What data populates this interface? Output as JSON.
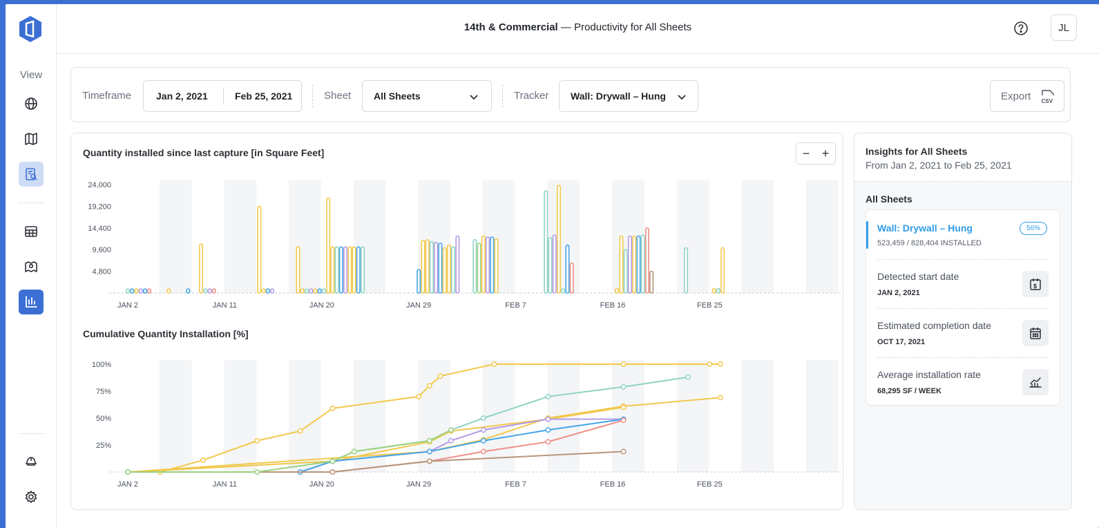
{
  "header": {
    "project": "14th & Commercial",
    "subtitle": " — Productivity for All Sheets",
    "avatar_initials": "JL"
  },
  "sidebar": {
    "view_label": "View",
    "items": [
      {
        "icon": "globe-icon"
      },
      {
        "icon": "map-icon"
      },
      {
        "icon": "report-icon",
        "state": "soft-selected"
      },
      {
        "icon": "table-icon"
      },
      {
        "icon": "map-pin-icon"
      },
      {
        "icon": "bar-chart-icon",
        "state": "active"
      },
      {
        "icon": "hard-hat-icon"
      },
      {
        "icon": "gear-icon"
      }
    ]
  },
  "filters": {
    "timeframe_label": "Timeframe",
    "start_date": "Jan 2, 2021",
    "end_date": "Feb 25, 2021",
    "sheet_label": "Sheet",
    "sheet_value": "All Sheets",
    "tracker_label": "Tracker",
    "tracker_value": "Wall: Drywall – Hung",
    "export_label": "Export",
    "export_icon": "csv-icon"
  },
  "zoom": {
    "minus": "−",
    "plus": "+"
  },
  "colors": {
    "yellow": "#f2c84b",
    "blue": "#45a5e6",
    "teal": "#8fd3c2",
    "purple": "#b59be6",
    "red": "#ee8f86",
    "brown": "#b8947a",
    "green": "#9ad27e",
    "accent": "#3b6fd4"
  },
  "chart_data": [
    {
      "type": "bar",
      "title": "Quantity installed since last capture [in Square Feet]",
      "x_ticks": [
        "JAN 2",
        "JAN 11",
        "JAN 20",
        "JAN 29",
        "FEB 7",
        "FEB 16",
        "FEB 25"
      ],
      "x_start_day": 0,
      "x_end_day": 67,
      "y_ticks": [
        "24,000",
        "19,200",
        "14,400",
        "9,600",
        "4,800"
      ],
      "ylim": [
        0,
        24000
      ],
      "bars": [
        {
          "day": 0.0,
          "color": "teal",
          "value": 300
        },
        {
          "day": 0.4,
          "color": "blue",
          "value": 300
        },
        {
          "day": 0.8,
          "color": "yellow",
          "value": 300
        },
        {
          "day": 1.2,
          "color": "purple",
          "value": 300
        },
        {
          "day": 1.6,
          "color": "blue",
          "value": 300
        },
        {
          "day": 2.0,
          "color": "red",
          "value": 300
        },
        {
          "day": 3.8,
          "color": "yellow",
          "value": 300
        },
        {
          "day": 5.6,
          "color": "blue",
          "value": 300
        },
        {
          "day": 6.8,
          "color": "yellow",
          "value": 10800
        },
        {
          "day": 7.2,
          "color": "teal",
          "value": 300
        },
        {
          "day": 7.6,
          "color": "purple",
          "value": 300
        },
        {
          "day": 8.0,
          "color": "red",
          "value": 300
        },
        {
          "day": 12.2,
          "color": "yellow",
          "value": 19200
        },
        {
          "day": 12.6,
          "color": "yellow",
          "value": 300
        },
        {
          "day": 13.0,
          "color": "blue",
          "value": 300
        },
        {
          "day": 13.4,
          "color": "purple",
          "value": 300
        },
        {
          "day": 15.8,
          "color": "yellow",
          "value": 10200
        },
        {
          "day": 16.2,
          "color": "yellow",
          "value": 300
        },
        {
          "day": 16.6,
          "color": "teal",
          "value": 300
        },
        {
          "day": 17.0,
          "color": "purple",
          "value": 300
        },
        {
          "day": 17.4,
          "color": "yellow",
          "value": 300
        },
        {
          "day": 17.8,
          "color": "blue",
          "value": 300
        },
        {
          "day": 18.2,
          "color": "teal",
          "value": 300
        },
        {
          "day": 18.6,
          "color": "yellow",
          "value": 21000
        },
        {
          "day": 19.0,
          "color": "yellow",
          "value": 10200
        },
        {
          "day": 19.4,
          "color": "teal",
          "value": 10200
        },
        {
          "day": 19.8,
          "color": "blue",
          "value": 10200
        },
        {
          "day": 20.2,
          "color": "purple",
          "value": 10200
        },
        {
          "day": 20.6,
          "color": "yellow",
          "value": 10200
        },
        {
          "day": 21.0,
          "color": "yellow",
          "value": 10200
        },
        {
          "day": 21.4,
          "color": "blue",
          "value": 10200
        },
        {
          "day": 21.8,
          "color": "teal",
          "value": 10200
        },
        {
          "day": 27.0,
          "color": "blue",
          "value": 5200
        },
        {
          "day": 27.4,
          "color": "yellow",
          "value": 11600
        },
        {
          "day": 27.8,
          "color": "yellow",
          "value": 11800
        },
        {
          "day": 28.2,
          "color": "teal",
          "value": 11400
        },
        {
          "day": 28.6,
          "color": "purple",
          "value": 11200
        },
        {
          "day": 29.0,
          "color": "blue",
          "value": 11000
        },
        {
          "day": 29.4,
          "color": "yellow",
          "value": 10000
        },
        {
          "day": 29.8,
          "color": "yellow",
          "value": 10600
        },
        {
          "day": 30.2,
          "color": "teal",
          "value": 10200
        },
        {
          "day": 30.6,
          "color": "purple",
          "value": 12600
        },
        {
          "day": 32.2,
          "color": "teal",
          "value": 11800
        },
        {
          "day": 32.6,
          "color": "green",
          "value": 11000
        },
        {
          "day": 33.0,
          "color": "yellow",
          "value": 12600
        },
        {
          "day": 33.4,
          "color": "purple",
          "value": 12400
        },
        {
          "day": 33.8,
          "color": "blue",
          "value": 12400
        },
        {
          "day": 34.2,
          "color": "yellow",
          "value": 12000
        },
        {
          "day": 38.8,
          "color": "teal",
          "value": 22600
        },
        {
          "day": 39.2,
          "color": "teal",
          "value": 12200
        },
        {
          "day": 39.6,
          "color": "purple",
          "value": 12800
        },
        {
          "day": 40.0,
          "color": "yellow",
          "value": 23800
        },
        {
          "day": 40.4,
          "color": "teal",
          "value": 300
        },
        {
          "day": 40.8,
          "color": "blue",
          "value": 10600
        },
        {
          "day": 41.2,
          "color": "red",
          "value": 6600
        },
        {
          "day": 45.4,
          "color": "yellow",
          "value": 1000
        },
        {
          "day": 45.8,
          "color": "yellow",
          "value": 12600
        },
        {
          "day": 46.2,
          "color": "teal",
          "value": 9600
        },
        {
          "day": 46.6,
          "color": "purple",
          "value": 12600
        },
        {
          "day": 47.0,
          "color": "yellow",
          "value": 12600
        },
        {
          "day": 47.4,
          "color": "blue",
          "value": 12600
        },
        {
          "day": 47.8,
          "color": "teal",
          "value": 12800
        },
        {
          "day": 48.2,
          "color": "red",
          "value": 14400
        },
        {
          "day": 48.6,
          "color": "brown",
          "value": 4800
        },
        {
          "day": 51.8,
          "color": "teal",
          "value": 10000
        },
        {
          "day": 54.4,
          "color": "yellow",
          "value": 1000
        },
        {
          "day": 54.8,
          "color": "teal",
          "value": 1000
        },
        {
          "day": 55.2,
          "color": "yellow",
          "value": 10000
        }
      ]
    },
    {
      "type": "line",
      "title": "Cumulative Quantity Installation [%]",
      "x_ticks": [
        "JAN 2",
        "JAN 11",
        "JAN 20",
        "JAN 29",
        "FEB 7",
        "FEB 16",
        "FEB 25"
      ],
      "y_ticks": [
        "100%",
        "75%",
        "50%",
        "25%"
      ],
      "ylim": [
        0,
        100
      ],
      "series": [
        {
          "color": "yellow",
          "points": [
            [
              0,
              0
            ],
            [
              3,
              0
            ],
            [
              7,
              11
            ],
            [
              12,
              29
            ],
            [
              16,
              38
            ],
            [
              19,
              59
            ],
            [
              27,
              70
            ],
            [
              28,
              80
            ],
            [
              29,
              89
            ],
            [
              34,
              100
            ],
            [
              46,
              100
            ],
            [
              54,
              100
            ],
            [
              55,
              100
            ]
          ]
        },
        {
          "color": "teal",
          "points": [
            [
              0,
              0
            ],
            [
              19,
              10
            ],
            [
              21,
              19
            ],
            [
              28,
              29
            ],
            [
              30,
              39
            ],
            [
              33,
              50
            ],
            [
              39,
              70
            ],
            [
              46,
              79
            ],
            [
              52,
              88
            ]
          ]
        },
        {
          "color": "yellow",
          "points": [
            [
              0,
              0
            ],
            [
              28,
              19
            ],
            [
              33,
              30
            ],
            [
              39,
              50
            ],
            [
              46,
              61
            ],
            [
              55,
              69
            ]
          ]
        },
        {
          "color": "yellow",
          "points": [
            [
              0,
              0
            ],
            [
              19,
              10
            ],
            [
              28,
              28
            ],
            [
              30,
              38
            ],
            [
              39,
              49
            ],
            [
              46,
              60
            ]
          ]
        },
        {
          "color": "purple",
          "points": [
            [
              0,
              0
            ],
            [
              16,
              0
            ],
            [
              19,
              10
            ],
            [
              28,
              19
            ],
            [
              30,
              29
            ],
            [
              33,
              39
            ],
            [
              39,
              49
            ],
            [
              46,
              49
            ]
          ]
        },
        {
          "color": "blue",
          "points": [
            [
              0,
              0
            ],
            [
              16,
              0
            ],
            [
              19,
              10
            ],
            [
              28,
              19
            ],
            [
              33,
              29
            ],
            [
              39,
              39
            ],
            [
              46,
              49
            ]
          ]
        },
        {
          "color": "red",
          "points": [
            [
              0,
              0
            ],
            [
              19,
              0
            ],
            [
              28,
              10
            ],
            [
              33,
              19
            ],
            [
              39,
              28
            ],
            [
              46,
              48
            ]
          ]
        },
        {
          "color": "brown",
          "points": [
            [
              0,
              0
            ],
            [
              19,
              0
            ],
            [
              28,
              10
            ],
            [
              46,
              19
            ]
          ]
        },
        {
          "color": "green",
          "points": [
            [
              0,
              0
            ],
            [
              12,
              0
            ],
            [
              19,
              10
            ],
            [
              21,
              19
            ],
            [
              28,
              29
            ],
            [
              30,
              39
            ]
          ]
        }
      ]
    }
  ],
  "insights": {
    "title": "Insights for All Sheets",
    "subtitle": "From Jan 2, 2021 to Feb 25, 2021",
    "section": "All Sheets",
    "tracker_name": "Wall: Drywall – Hung",
    "tracker_progress": "523,459 / 828,404 INSTALLED",
    "tracker_pct": "56%",
    "rows": [
      {
        "label": "Detected start date",
        "value": "JAN 2, 2021",
        "icon": "dollar-calendar-icon"
      },
      {
        "label": "Estimated completion date",
        "value": "OCT 17, 2021",
        "icon": "calendar-icon"
      },
      {
        "label": "Average installation rate",
        "value": "68,295 SF / WEEK",
        "icon": "trend-chart-icon"
      }
    ]
  }
}
